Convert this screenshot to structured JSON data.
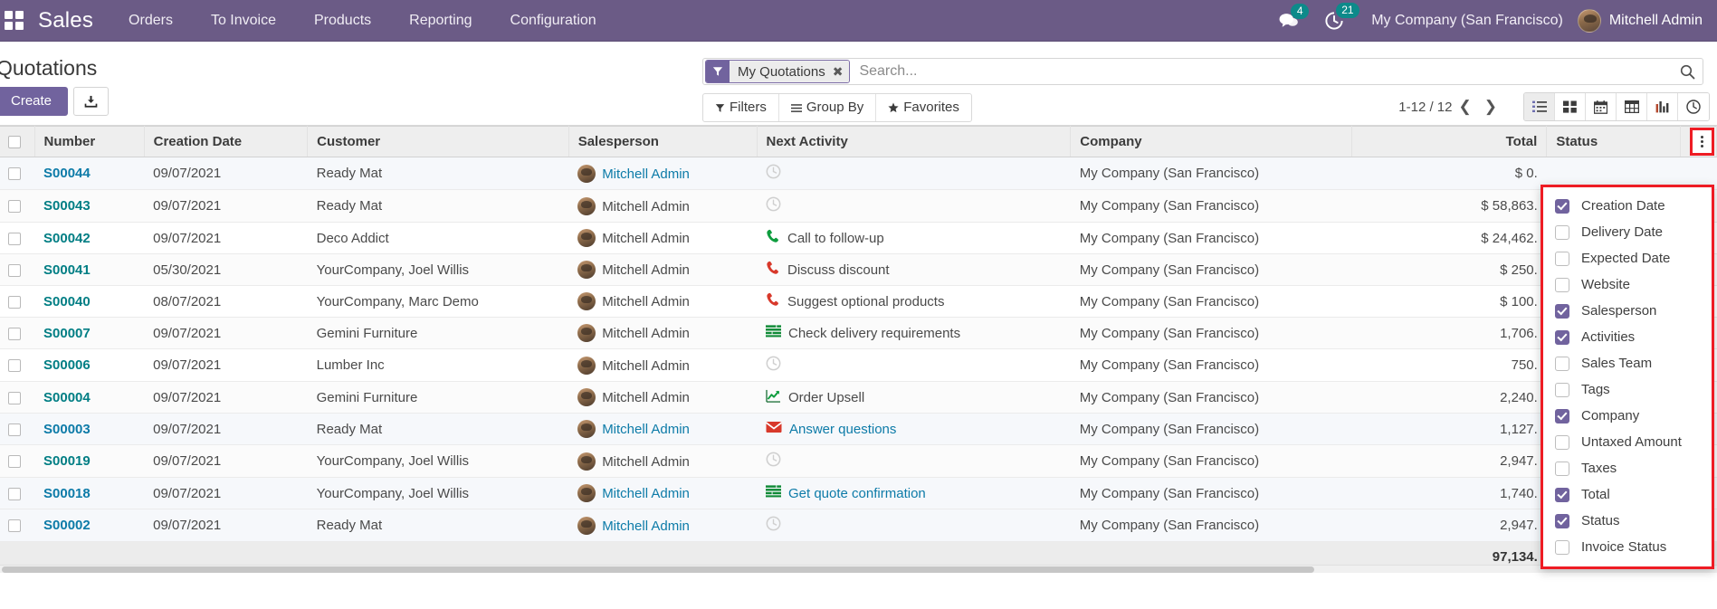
{
  "navbar": {
    "apps_icon": "apps-grid-icon",
    "brand": "Sales",
    "menu": [
      {
        "label": "Orders"
      },
      {
        "label": "To Invoice"
      },
      {
        "label": "Products"
      },
      {
        "label": "Reporting"
      },
      {
        "label": "Configuration"
      }
    ],
    "messages": {
      "icon": "chat-bubble-icon",
      "count": "4"
    },
    "activities": {
      "icon": "clock-activity-icon",
      "count": "21"
    },
    "company": "My Company (San Francisco)",
    "user": "Mitchell Admin",
    "avatar_icon": "user-avatar"
  },
  "control_panel": {
    "title": "Quotations",
    "create_label": "Create",
    "import_icon": "import-download-icon",
    "search": {
      "facet_icon": "filter-funnel-icon",
      "facet_label": "My Quotations",
      "facet_remove_icon": "remove-facet-icon",
      "placeholder": "Search...",
      "value": "",
      "search_icon": "search-icon"
    },
    "filters": [
      {
        "icon": "filter-funnel-icon",
        "label": "Filters"
      },
      {
        "icon": "hamburger-lines-icon",
        "label": "Group By"
      },
      {
        "icon": "star-icon",
        "label": "Favorites"
      }
    ],
    "pager": {
      "range": "1-12 / 12",
      "prev_icon": "chevron-left-icon",
      "next_icon": "chevron-right-icon"
    },
    "view_switcher": [
      {
        "name": "list",
        "icon": "list-view-icon",
        "active": true
      },
      {
        "name": "kanban",
        "icon": "kanban-view-icon",
        "active": false
      },
      {
        "name": "calendar",
        "icon": "calendar-view-icon",
        "active": false
      },
      {
        "name": "pivot",
        "icon": "pivot-view-icon",
        "active": false
      },
      {
        "name": "graph",
        "icon": "graph-view-icon",
        "active": false
      },
      {
        "name": "activity",
        "icon": "activity-view-icon",
        "active": false
      }
    ]
  },
  "list": {
    "columns": [
      {
        "key": "number",
        "label": "Number",
        "align": "left"
      },
      {
        "key": "creation_date",
        "label": "Creation Date",
        "align": "left"
      },
      {
        "key": "customer",
        "label": "Customer",
        "align": "left"
      },
      {
        "key": "salesperson",
        "label": "Salesperson",
        "align": "left"
      },
      {
        "key": "next_activity",
        "label": "Next Activity",
        "align": "left"
      },
      {
        "key": "company",
        "label": "Company",
        "align": "left"
      },
      {
        "key": "total",
        "label": "Total",
        "align": "right"
      },
      {
        "key": "status",
        "label": "Status",
        "align": "left"
      }
    ],
    "optional_columns_icon": "vertical-dots-icon",
    "rows": [
      {
        "number": "S00044",
        "creation_date": "09/07/2021",
        "customer": "Ready Mat",
        "salesperson": "Mitchell Admin",
        "activity_icon": "clock-grey-icon",
        "activity_label": "",
        "company": "My Company (San Francisco)",
        "total": "$ 0.",
        "status": "",
        "highlight": true
      },
      {
        "number": "S00043",
        "creation_date": "09/07/2021",
        "customer": "Ready Mat",
        "salesperson": "Mitchell Admin",
        "activity_icon": "clock-grey-icon",
        "activity_label": "",
        "company": "My Company (San Francisco)",
        "total": "$ 58,863.",
        "status": "",
        "highlight": false
      },
      {
        "number": "S00042",
        "creation_date": "09/07/2021",
        "customer": "Deco Addict",
        "salesperson": "Mitchell Admin",
        "activity_icon": "phone-green-icon",
        "activity_label": "Call to follow-up",
        "company": "My Company (San Francisco)",
        "total": "$ 24,462.",
        "status": "",
        "highlight": false
      },
      {
        "number": "S00041",
        "creation_date": "05/30/2021",
        "customer": "YourCompany, Joel Willis",
        "salesperson": "Mitchell Admin",
        "activity_icon": "phone-red-icon",
        "activity_label": "Discuss discount",
        "company": "My Company (San Francisco)",
        "total": "$ 250.",
        "status": "",
        "highlight": false
      },
      {
        "number": "S00040",
        "creation_date": "08/07/2021",
        "customer": "YourCompany, Marc Demo",
        "salesperson": "Mitchell Admin",
        "activity_icon": "phone-red-icon",
        "activity_label": "Suggest optional products",
        "company": "My Company (San Francisco)",
        "total": "$ 100.",
        "status": "",
        "highlight": false
      },
      {
        "number": "S00007",
        "creation_date": "09/07/2021",
        "customer": "Gemini Furniture",
        "salesperson": "Mitchell Admin",
        "activity_icon": "list-green-icon",
        "activity_label": "Check delivery requirements",
        "company": "My Company (San Francisco)",
        "total": "1,706.",
        "status": "",
        "highlight": false
      },
      {
        "number": "S00006",
        "creation_date": "09/07/2021",
        "customer": "Lumber Inc",
        "salesperson": "Mitchell Admin",
        "activity_icon": "clock-grey-icon",
        "activity_label": "",
        "company": "My Company (San Francisco)",
        "total": "750.",
        "status": "",
        "highlight": false
      },
      {
        "number": "S00004",
        "creation_date": "09/07/2021",
        "customer": "Gemini Furniture",
        "salesperson": "Mitchell Admin",
        "activity_icon": "chart-green-icon",
        "activity_label": "Order Upsell",
        "company": "My Company (San Francisco)",
        "total": "2,240.",
        "status": "",
        "highlight": false
      },
      {
        "number": "S00003",
        "creation_date": "09/07/2021",
        "customer": "Ready Mat",
        "salesperson": "Mitchell Admin",
        "activity_icon": "envelope-red-icon",
        "activity_label": "Answer questions",
        "company": "My Company (San Francisco)",
        "total": "1,127.",
        "status": "",
        "highlight": true
      },
      {
        "number": "S00019",
        "creation_date": "09/07/2021",
        "customer": "YourCompany, Joel Willis",
        "salesperson": "Mitchell Admin",
        "activity_icon": "clock-grey-icon",
        "activity_label": "",
        "company": "My Company (San Francisco)",
        "total": "2,947.",
        "status": "",
        "highlight": false
      },
      {
        "number": "S00018",
        "creation_date": "09/07/2021",
        "customer": "YourCompany, Joel Willis",
        "salesperson": "Mitchell Admin",
        "activity_icon": "list-green-icon",
        "activity_label": "Get quote confirmation",
        "company": "My Company (San Francisco)",
        "total": "1,740.",
        "status": "",
        "highlight": true
      },
      {
        "number": "S00002",
        "creation_date": "09/07/2021",
        "customer": "Ready Mat",
        "salesperson": "Mitchell Admin",
        "activity_icon": "clock-grey-icon",
        "activity_label": "",
        "company": "My Company (San Francisco)",
        "total": "2,947.",
        "status": "",
        "highlight": true
      }
    ],
    "footer_total": "97,134."
  },
  "optional_columns_menu": {
    "items": [
      {
        "label": "Creation Date",
        "checked": true
      },
      {
        "label": "Delivery Date",
        "checked": false
      },
      {
        "label": "Expected Date",
        "checked": false
      },
      {
        "label": "Website",
        "checked": false
      },
      {
        "label": "Salesperson",
        "checked": true
      },
      {
        "label": "Activities",
        "checked": true
      },
      {
        "label": "Sales Team",
        "checked": false
      },
      {
        "label": "Tags",
        "checked": false
      },
      {
        "label": "Company",
        "checked": true
      },
      {
        "label": "Untaxed Amount",
        "checked": false
      },
      {
        "label": "Taxes",
        "checked": false
      },
      {
        "label": "Total",
        "checked": true
      },
      {
        "label": "Status",
        "checked": true
      },
      {
        "label": "Invoice Status",
        "checked": false
      }
    ]
  },
  "colors": {
    "brand_purple": "#6b5b86",
    "accent_purple": "#71639e",
    "badge_teal": "#0d8a8a",
    "link_blue": "#0d7ba8",
    "record_teal": "#017e84",
    "highlight_red": "#ee1c24"
  }
}
